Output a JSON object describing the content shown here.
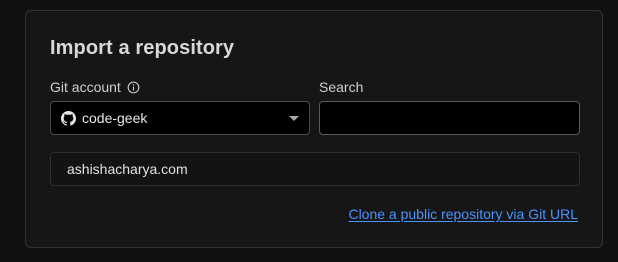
{
  "import": {
    "title": "Import a repository",
    "git_account_label": "Git account",
    "git_account_value": "code-geek",
    "search_label": "Search",
    "search_value": "",
    "search_placeholder": "",
    "repositories": [
      {
        "name": "ashishacharya.com"
      }
    ],
    "clone_link": "Clone a public repository via Git URL"
  },
  "icons": {
    "info": "info-icon",
    "account": "github-icon",
    "dropdown": "caret-down-icon"
  },
  "colors": {
    "background": "#111111",
    "card": "#161616",
    "input_bg": "#000000",
    "link": "#4b93ff",
    "text": "#d8d8d8"
  }
}
